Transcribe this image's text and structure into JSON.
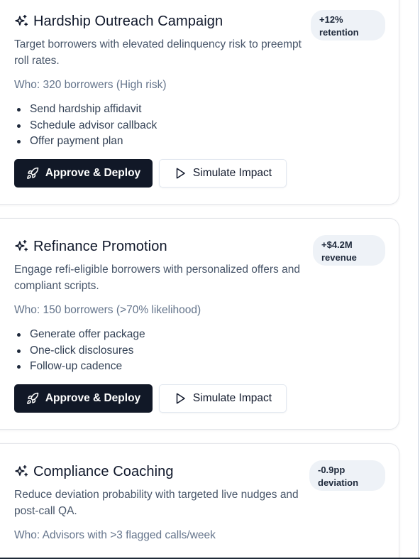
{
  "cards": [
    {
      "title": "Hardship Outreach Campaign",
      "description": "Target borrowers with elevated delinquency risk to preempt roll rates.",
      "who": "Who: 320 borrowers (High risk)",
      "steps": [
        "Send hardship affidavit",
        "Schedule advisor callback",
        "Offer payment plan"
      ],
      "badge": {
        "value": "+12%",
        "label": "retention"
      },
      "primary_label": "Approve & Deploy",
      "secondary_label": "Simulate Impact"
    },
    {
      "title": "Refinance Promotion",
      "description": "Engage refi-eligible borrowers with personalized offers and compliant scripts.",
      "who": "Who: 150 borrowers (>70% likelihood)",
      "steps": [
        "Generate offer package",
        "One-click disclosures",
        "Follow-up cadence"
      ],
      "badge": {
        "value": "+$4.2M",
        "label": "revenue"
      },
      "primary_label": "Approve & Deploy",
      "secondary_label": "Simulate Impact"
    },
    {
      "title": "Compliance Coaching",
      "description": "Reduce deviation probability with targeted live nudges and post-call QA.",
      "who": "Who: Advisors with >3 flagged calls/week",
      "steps": [],
      "badge": {
        "value": "-0.9pp",
        "label": "deviation"
      }
    }
  ],
  "icons": {
    "title": "sparkles-icon",
    "primary": "rocket-icon",
    "secondary": "play-icon"
  },
  "colors": {
    "primary_button": "#111827",
    "badge_bg": "#eef2f7",
    "muted_text": "#64748b"
  }
}
